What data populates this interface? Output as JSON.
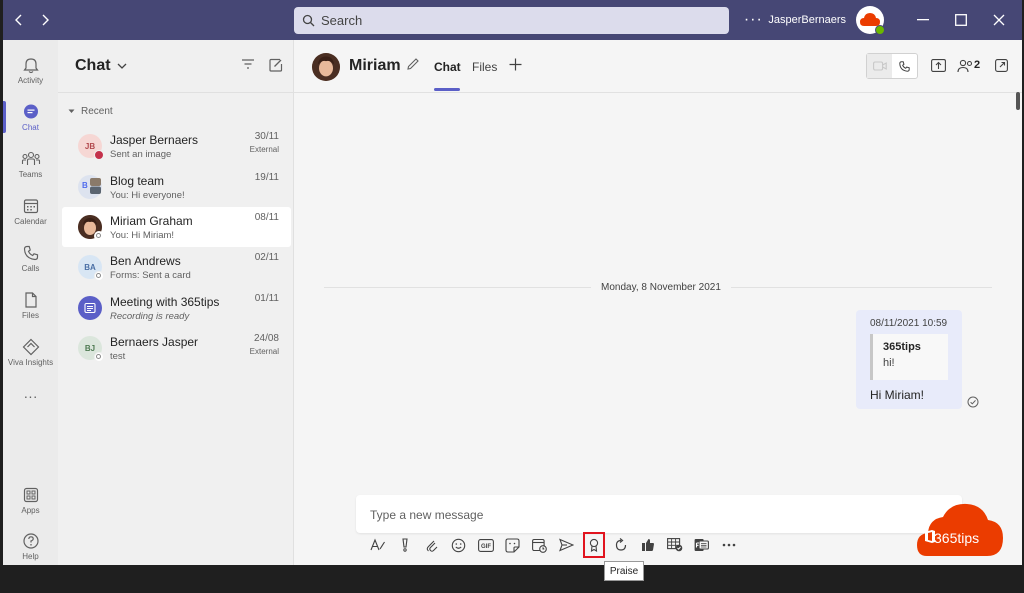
{
  "titlebar": {
    "search_placeholder": "Search",
    "more": "···",
    "user_name": "JasperBernaers"
  },
  "rail": {
    "items": [
      {
        "label": "Activity",
        "icon": "bell-icon"
      },
      {
        "label": "Chat",
        "icon": "chat-icon",
        "active": true
      },
      {
        "label": "Teams",
        "icon": "teams-icon"
      },
      {
        "label": "Calendar",
        "icon": "calendar-icon"
      },
      {
        "label": "Calls",
        "icon": "phone-icon"
      },
      {
        "label": "Files",
        "icon": "file-icon"
      },
      {
        "label": "Viva Insights",
        "icon": "insights-icon"
      }
    ],
    "more": "···",
    "apps_label": "Apps",
    "help_label": "Help"
  },
  "chatlist": {
    "title": "Chat",
    "recent_label": "Recent",
    "conversations": [
      {
        "initials": "JB",
        "name": "Jasper Bernaers",
        "preview": "Sent an image",
        "date": "30/11",
        "external": "External",
        "avatar_bg": "#f6d7d4",
        "avatar_fg": "#b2494d",
        "status": "#c4314b"
      },
      {
        "initials": "B",
        "name": "Blog team",
        "preview": "You: Hi everyone!",
        "date": "19/11",
        "external": "",
        "avatar_bg": "#dde3ef",
        "avatar_fg": "#4f6bed"
      },
      {
        "initials": "",
        "name": "Miriam Graham",
        "preview": "You: Hi Miriam!",
        "date": "08/11",
        "external": "",
        "selected": true
      },
      {
        "initials": "BA",
        "name": "Ben Andrews",
        "preview": "Forms: Sent a card",
        "date": "02/11",
        "external": "",
        "avatar_bg": "#d8e6f4",
        "avatar_fg": "#4a6fa5"
      },
      {
        "initials": "",
        "name": "Meeting with 365tips",
        "preview": "Recording is ready",
        "date": "01/11",
        "external": "",
        "meeting": true
      },
      {
        "initials": "BJ",
        "name": "Bernaers Jasper",
        "preview": "test",
        "date": "24/08",
        "external": "External",
        "avatar_bg": "#dbe6dc",
        "avatar_fg": "#4e7a52"
      }
    ]
  },
  "main": {
    "contact_name": "Miriam",
    "tabs": [
      "Chat",
      "Files"
    ],
    "people_count": "2",
    "day_divider": "Monday, 8 November 2021",
    "message": {
      "timestamp": "08/11/2021 10:59",
      "quote_author": "365tips",
      "quote_text": "hi!",
      "text": "Hi Miriam!"
    },
    "compose_placeholder": "Type a new message",
    "tooltip": "Praise"
  },
  "watermark": {
    "text": "365tips"
  },
  "colors": {
    "titlebar": "#464775",
    "accent": "#5b5fc7",
    "highlight": "#e1141e",
    "watermark": "#eb3c00"
  }
}
